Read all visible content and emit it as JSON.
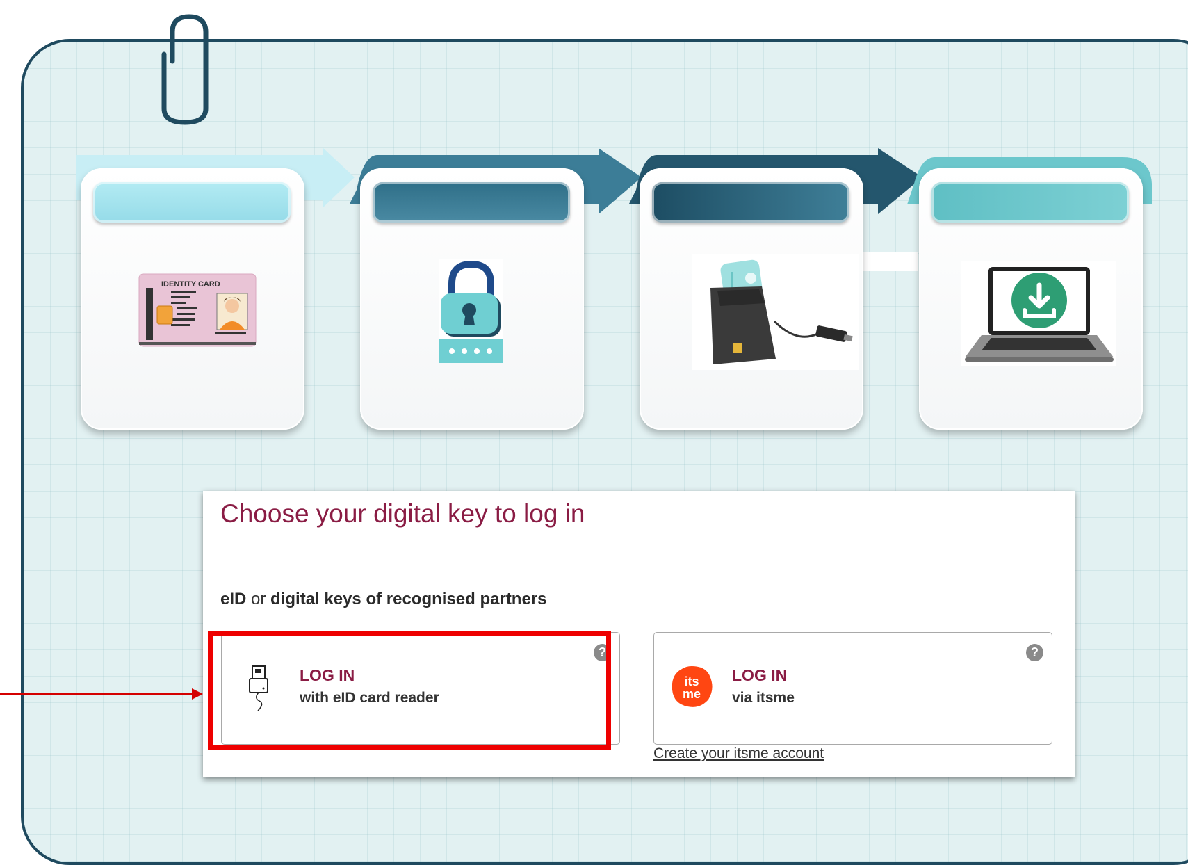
{
  "login": {
    "title": "Choose your digital key to log in",
    "subtitle_bold1": "eID",
    "subtitle_or": " or ",
    "subtitle_bold2": "digital keys of recognised partners",
    "options": [
      {
        "title": "LOG IN",
        "subtitle": "with eID card reader",
        "help": "?",
        "icon": "card-reader-icon"
      },
      {
        "title": "LOG IN",
        "subtitle": "via itsme",
        "help": "?",
        "icon": "itsme-logo"
      }
    ],
    "create_link": "Create your itsme account"
  },
  "steps": [
    {
      "icon": "identity-card-icon",
      "card_text": "IDENTITY CARD",
      "tab_color": "#a8e4ee"
    },
    {
      "icon": "padlock-pin-icon",
      "tab_color": "#3f7f97"
    },
    {
      "icon": "card-reader-icon",
      "tab_color": "#245a70"
    },
    {
      "icon": "laptop-download-icon",
      "tab_color": "#6cc7cc"
    }
  ],
  "colors": {
    "board_border": "#1f4a5f",
    "board_bg": "#e2f1f2",
    "accent_title": "#8a1c44",
    "highlight": "#ee0000",
    "itsme": "#ff4612",
    "download_green": "#2e9e74"
  }
}
